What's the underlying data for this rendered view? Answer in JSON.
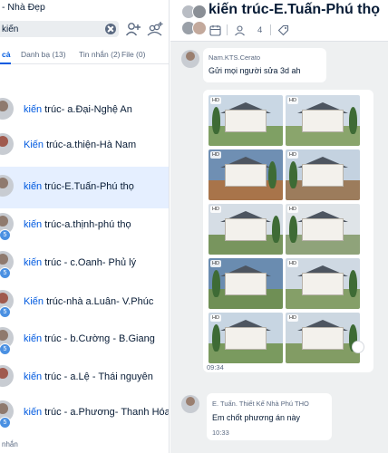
{
  "app": {
    "title": "- Nhà Đẹp"
  },
  "search": {
    "value": "kiến"
  },
  "tabs": [
    {
      "label": "cả"
    },
    {
      "label": "Danh bạ (13)"
    },
    {
      "label": "Tin nhắn (2)"
    },
    {
      "label": "File (0)"
    }
  ],
  "conversations": [
    {
      "prefix": "kiến",
      "rest": " trúc- a.Đại-Nghệ An"
    },
    {
      "prefix": "Kiến",
      "rest": " trúc-a.thiện-Hà Nam"
    },
    {
      "prefix": "kiến",
      "rest": " trúc-E.Tuấn-Phú thọ"
    },
    {
      "prefix": "kiến",
      "rest": " trúc-a.thịnh-phú thọ"
    },
    {
      "prefix": "kiến",
      "rest": " trúc - c.Oanh- Phủ lý"
    },
    {
      "prefix": "Kiến",
      "rest": " trúc-nhà a.Luân- V.Phúc"
    },
    {
      "prefix": "kiến",
      "rest": " trúc - b.Cường - B.Giang"
    },
    {
      "prefix": "kiến",
      "rest": " trúc - a.Lệ - Thái nguyên"
    },
    {
      "prefix": "kiến",
      "rest": " trúc - a.Phương- Thanh Hóa"
    }
  ],
  "conversation_badges": [
    "5",
    "5",
    "5",
    "5",
    "5"
  ],
  "left_bottom_text": "nhắn",
  "chat": {
    "title": "kiến trúc-E.Tuấn-Phú thọ",
    "member_count": "4",
    "messages": [
      {
        "sender": "Nam.KTS.Cerato",
        "text": "Gửi mọi người sửa 3d ah"
      },
      {
        "time": "09:34"
      },
      {
        "sender": "E. Tuấn. Thiết Kế Nhà Phú THO",
        "text": "Em chốt phương án này",
        "time": "10:33"
      }
    ],
    "photo_badge": "HD"
  },
  "colors": {
    "accent": "#005ae0",
    "selected_row": "#e5efff",
    "chat_bg": "#eef0f1"
  },
  "icons": [
    "search-clear-icon",
    "add-friend-icon",
    "create-group-icon",
    "calendar-icon",
    "member-icon",
    "tag-icon",
    "like-icon"
  ]
}
